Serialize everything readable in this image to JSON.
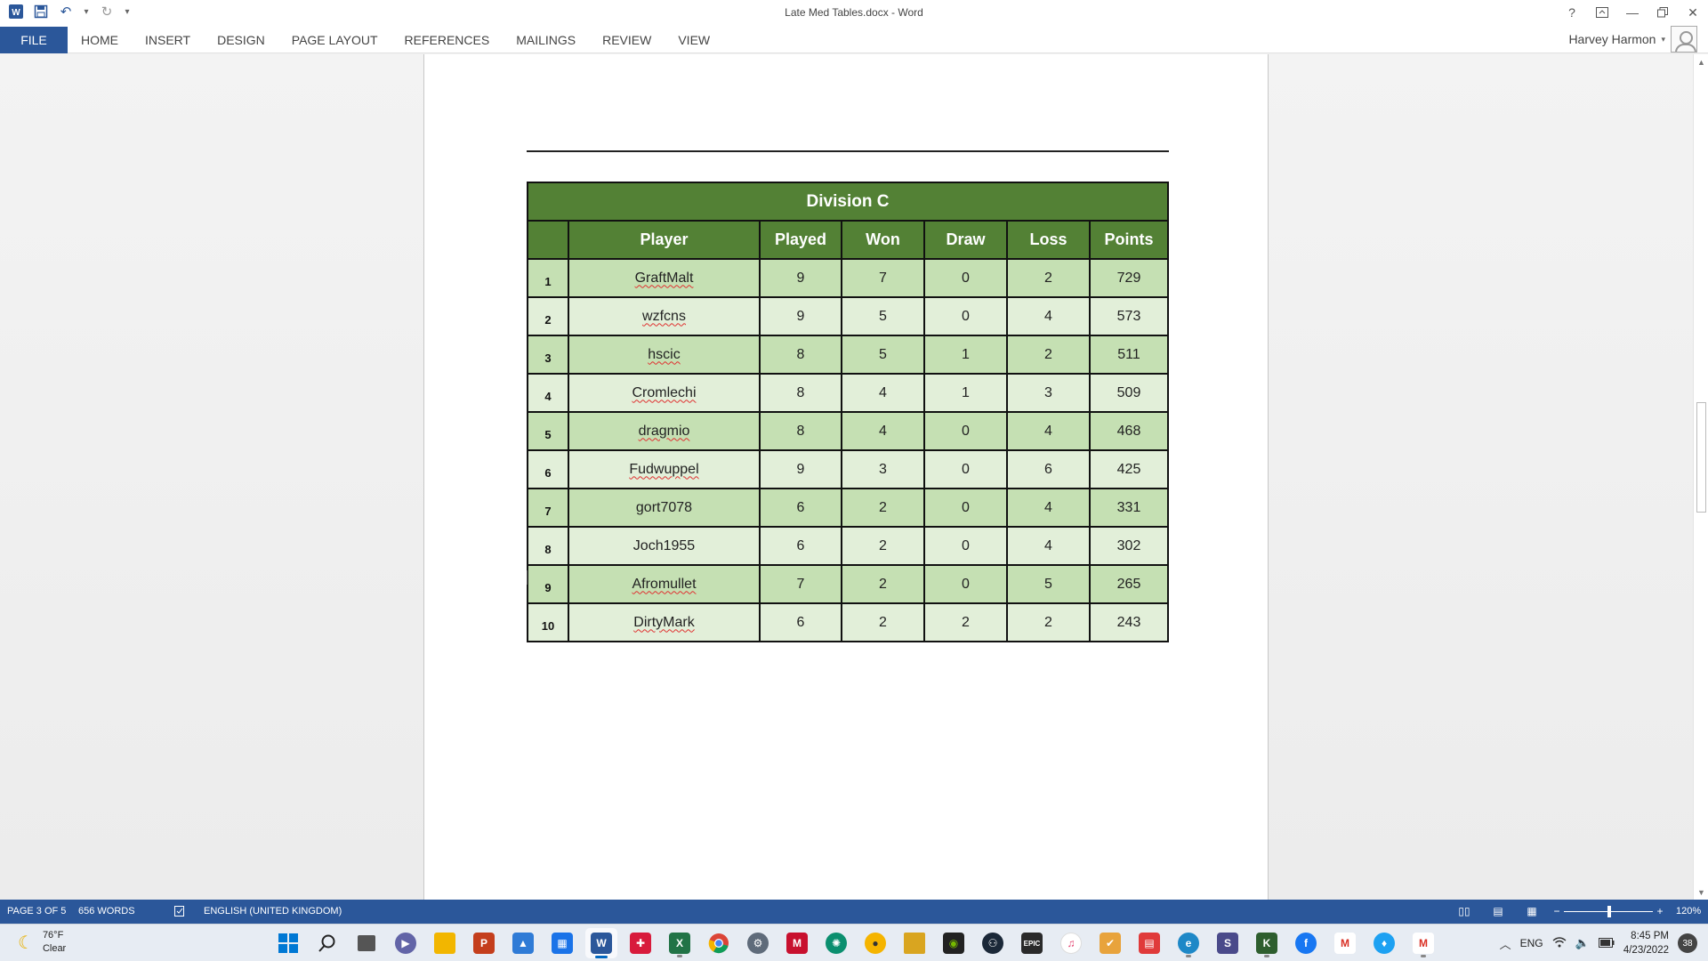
{
  "window": {
    "title": "Late Med Tables.docx - Word",
    "user": "Harvey Harmon"
  },
  "ribbon": {
    "file": "FILE",
    "tabs": [
      "HOME",
      "INSERT",
      "DESIGN",
      "PAGE LAYOUT",
      "REFERENCES",
      "MAILINGS",
      "REVIEW",
      "VIEW"
    ]
  },
  "table": {
    "title": "Division C",
    "headers": [
      "",
      "Player",
      "Played",
      "Won",
      "Draw",
      "Loss",
      "Points"
    ],
    "rows": [
      [
        "1",
        "GraftMalt",
        "9",
        "7",
        "0",
        "2",
        "729"
      ],
      [
        "2",
        "wzfcns",
        "9",
        "5",
        "0",
        "4",
        "573"
      ],
      [
        "3",
        "hscic",
        "8",
        "5",
        "1",
        "2",
        "511"
      ],
      [
        "4",
        "Cromlechi",
        "8",
        "4",
        "1",
        "3",
        "509"
      ],
      [
        "5",
        "dragmio",
        "8",
        "4",
        "0",
        "4",
        "468"
      ],
      [
        "6",
        "Fudwuppel",
        "9",
        "3",
        "0",
        "6",
        "425"
      ],
      [
        "7",
        "gort7078",
        "6",
        "2",
        "0",
        "4",
        "331"
      ],
      [
        "8",
        "Joch1955",
        "6",
        "2",
        "0",
        "4",
        "302"
      ],
      [
        "9",
        "Afromullet",
        "7",
        "2",
        "0",
        "5",
        "265"
      ],
      [
        "10",
        "DirtyMark",
        "6",
        "2",
        "2",
        "2",
        "243"
      ]
    ],
    "misspelled": [
      "GraftMalt",
      "wzfcns",
      "hscic",
      "Cromlechi",
      "dragmio",
      "Fudwuppel",
      "Afromullet",
      "DirtyMark"
    ]
  },
  "status": {
    "page": "PAGE 3 OF 5",
    "words": "656 WORDS",
    "language": "ENGLISH (UNITED KINGDOM)",
    "zoom": "120%"
  },
  "taskbar": {
    "weather_temp": "76°F",
    "weather_desc": "Clear",
    "lang": "ENG",
    "time": "8:45 PM",
    "date": "4/23/2022",
    "notifications": "38"
  },
  "colors": {
    "word_blue": "#2b579a",
    "table_header_green": "#538135",
    "row_green_dark": "#c5e0b3",
    "row_green_light": "#e2efd9"
  }
}
